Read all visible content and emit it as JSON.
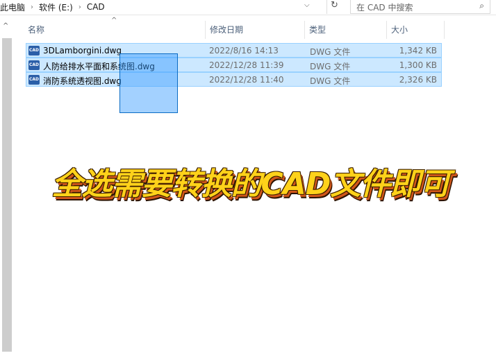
{
  "breadcrumb": [
    "此电脑",
    "软件 (E:)",
    "CAD"
  ],
  "search": {
    "placeholder": "在 CAD 中搜索"
  },
  "columns": {
    "name": "名称",
    "date": "修改日期",
    "type": "类型",
    "size": "大小"
  },
  "files": [
    {
      "name": "3DLamborgini.dwg",
      "date": "2022/8/16 14:13",
      "type": "DWG 文件",
      "size": "1,342 KB"
    },
    {
      "name": "人防给排水平面和系统图.dwg",
      "date": "2022/12/28 11:39",
      "type": "DWG 文件",
      "size": "1,300 KB"
    },
    {
      "name": "消防系统透视图.dwg",
      "date": "2022/12/28 11:40",
      "type": "DWG 文件",
      "size": "2,326 KB"
    }
  ],
  "file_icon_label": "CAD",
  "banner": "全选需要转换的CAD文件即可"
}
